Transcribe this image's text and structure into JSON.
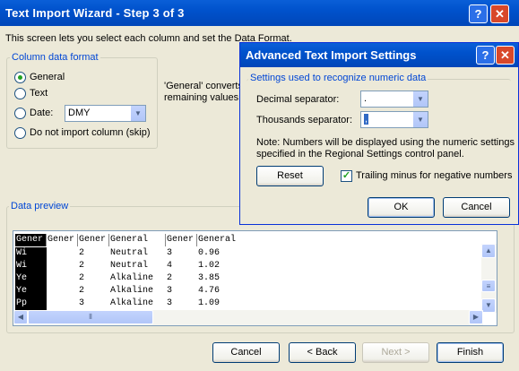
{
  "wizard": {
    "title": "Text Import Wizard - Step 3 of 3",
    "intro": "This screen lets you select each column and set the Data Format.",
    "column_format": {
      "group_label": "Column data format",
      "options": [
        "General",
        "Text",
        "Date:",
        "Do not import column (skip)"
      ],
      "date_value": "DMY",
      "selected": "General"
    },
    "general_note_1": "'General' converts",
    "general_note_2": "remaining values t",
    "preview": {
      "label": "Data preview",
      "headers": [
        "Gener",
        "Gener",
        "Gener",
        "General",
        "Gener",
        "General"
      ],
      "rows": [
        [
          "Wi",
          "",
          "2",
          "Neutral",
          "3",
          "0.96"
        ],
        [
          "Wi",
          "",
          "2",
          "Neutral",
          "4",
          "1.02"
        ],
        [
          "Ye",
          "",
          "2",
          "Alkaline",
          "2",
          "3.85"
        ],
        [
          "Ye",
          "",
          "2",
          "Alkaline",
          "3",
          "4.76"
        ],
        [
          "Pp",
          "",
          "3",
          "Alkaline",
          "3",
          "1.09"
        ]
      ]
    },
    "buttons": {
      "cancel": "Cancel",
      "back": "< Back",
      "next": "Next >",
      "finish": "Finish"
    }
  },
  "advanced": {
    "title": "Advanced Text Import Settings",
    "group_label": "Settings used to recognize numeric data",
    "decimal_label": "Decimal separator:",
    "decimal_value": ".",
    "thousands_label": "Thousands separator:",
    "thousands_value": ",",
    "note_1": "Note: Numbers will be displayed using the numeric settings",
    "note_2": "specified in the Regional Settings control panel.",
    "reset": "Reset",
    "trailing_minus": "Trailing minus for negative numbers",
    "trailing_minus_checked": true,
    "ok": "OK",
    "cancel": "Cancel"
  }
}
